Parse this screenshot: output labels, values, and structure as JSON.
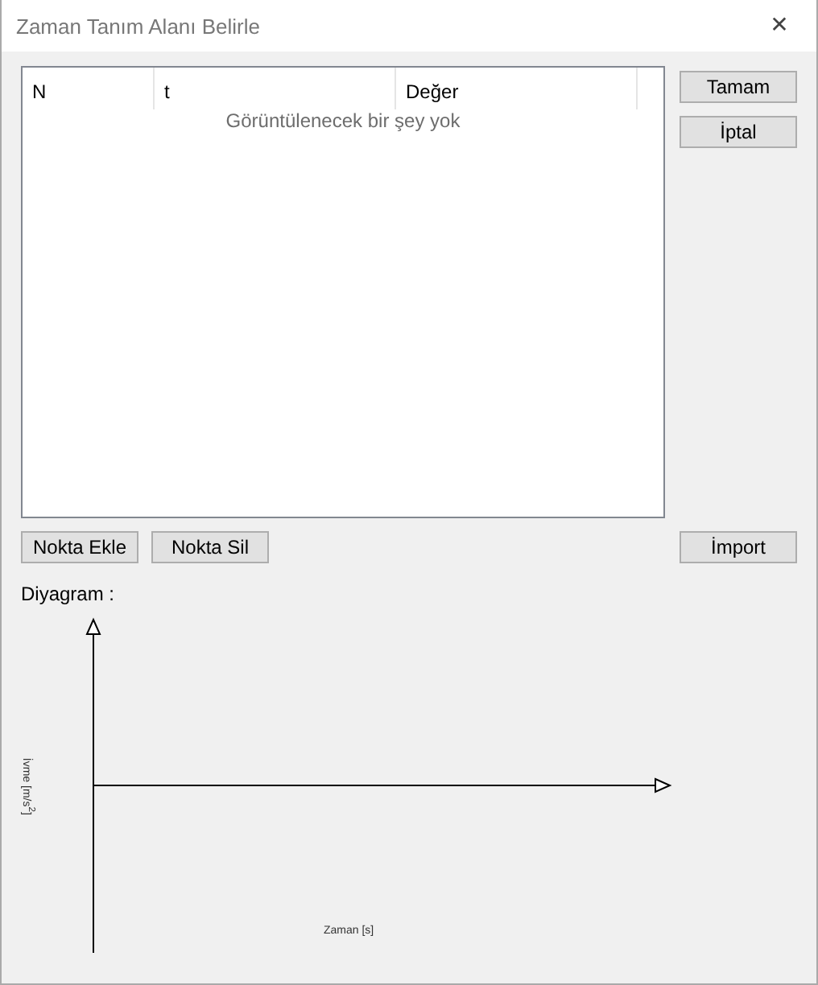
{
  "window": {
    "title": "Zaman Tanım Alanı Belirle",
    "close": "✕"
  },
  "table": {
    "columns": [
      "N",
      "t",
      "Değer"
    ],
    "empty_message": "Görüntülenecek bir şey yok"
  },
  "side_buttons": [
    "Tamam",
    "İptal"
  ],
  "point_buttons": [
    "Nokta Ekle",
    "Nokta Sil"
  ],
  "import_button": "İmport",
  "diagram": {
    "label": "Diyagram :",
    "ylabel": "İvme [m/s$^{2}$]",
    "xlabel": "Zaman [s]"
  }
}
